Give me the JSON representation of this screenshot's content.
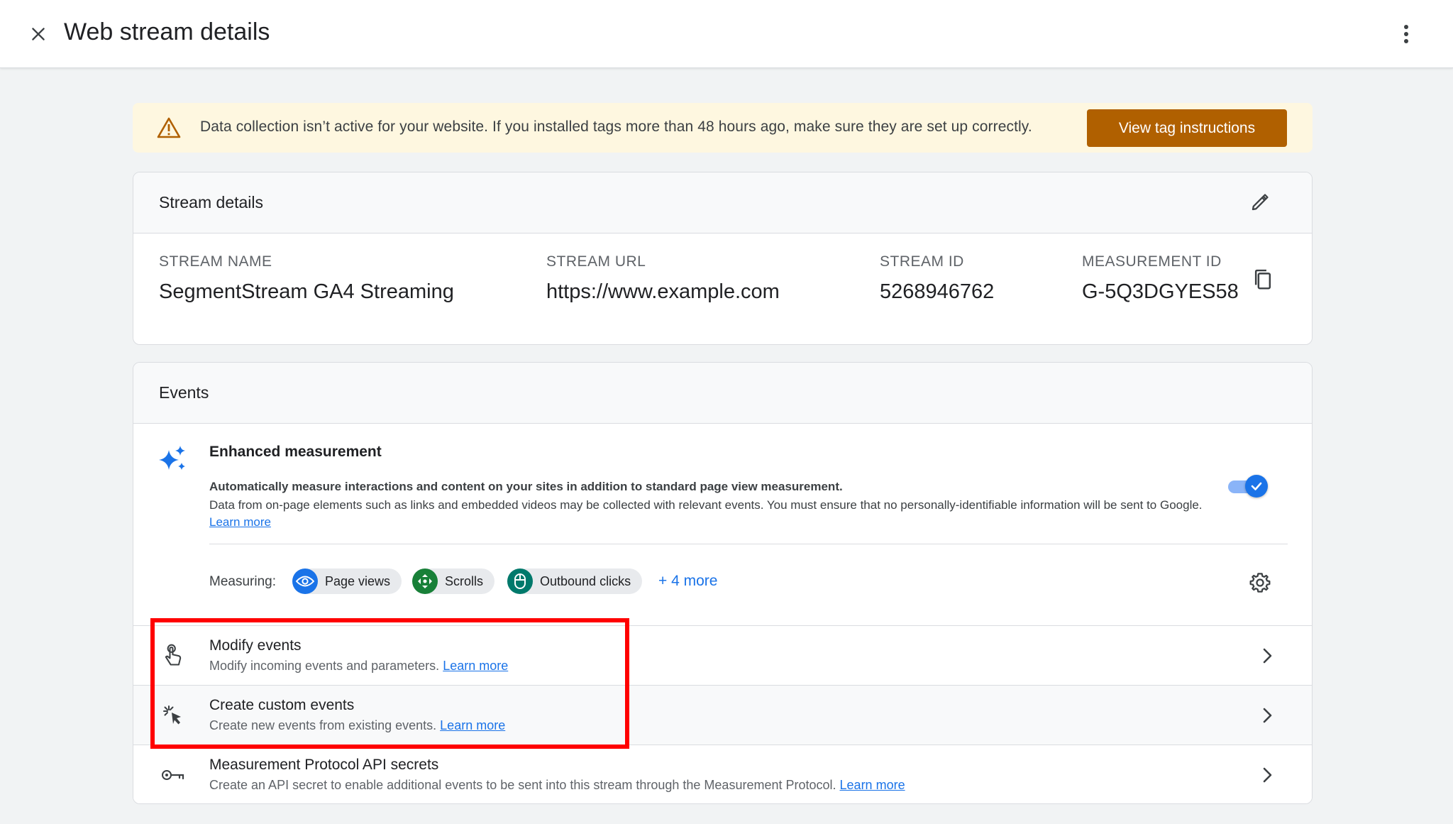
{
  "header": {
    "title": "Web stream details"
  },
  "banner": {
    "message": "Data collection isn’t active for your website. If you installed tags more than 48 hours ago, make sure they are set up correctly.",
    "cta_label": "View tag instructions",
    "color": "#b06000"
  },
  "stream_details": {
    "title": "Stream details",
    "fields": [
      {
        "label": "STREAM NAME",
        "value": "SegmentStream GA4 Streaming"
      },
      {
        "label": "STREAM URL",
        "value": "https://www.example.com"
      },
      {
        "label": "STREAM ID",
        "value": "5268946762"
      },
      {
        "label": "MEASUREMENT ID",
        "value": "G-5Q3DGYES58"
      }
    ]
  },
  "events": {
    "title": "Events",
    "enhanced": {
      "title": "Enhanced measurement",
      "desc_bold": "Automatically measure interactions and content on your sites in addition to standard page view measurement.",
      "desc": "Data from on-page elements such as links and embedded videos may be collected with relevant events. You must ensure that no personally-identifiable information will be sent to Google.",
      "learn_more": "Learn more",
      "enabled": true
    },
    "measuring": {
      "label": "Measuring:",
      "chips": [
        {
          "label": "Page views",
          "icon": "eye-icon",
          "color": "#1a73e8"
        },
        {
          "label": "Scrolls",
          "icon": "scroll-arrows-icon",
          "color": "#188038"
        },
        {
          "label": "Outbound clicks",
          "icon": "mouse-icon",
          "color": "#00796b"
        }
      ],
      "more": "+ 4 more"
    },
    "rows": [
      {
        "title": "Modify events",
        "subtitle": "Modify incoming events and parameters.",
        "link": "Learn more",
        "icon": "touch-hand-icon"
      },
      {
        "title": "Create custom events",
        "subtitle": "Create new events from existing events.",
        "link": "Learn more",
        "icon": "cursor-sparkle-icon"
      },
      {
        "title": "Measurement Protocol API secrets",
        "subtitle": "Create an API secret to enable additional events to be sent into this stream through the Measurement Protocol.",
        "link": "Learn more",
        "icon": "key-icon"
      }
    ]
  },
  "colors": {
    "accent": "#1a73e8",
    "highlight": "#ff0000",
    "banner_bg": "#fef7e0"
  }
}
